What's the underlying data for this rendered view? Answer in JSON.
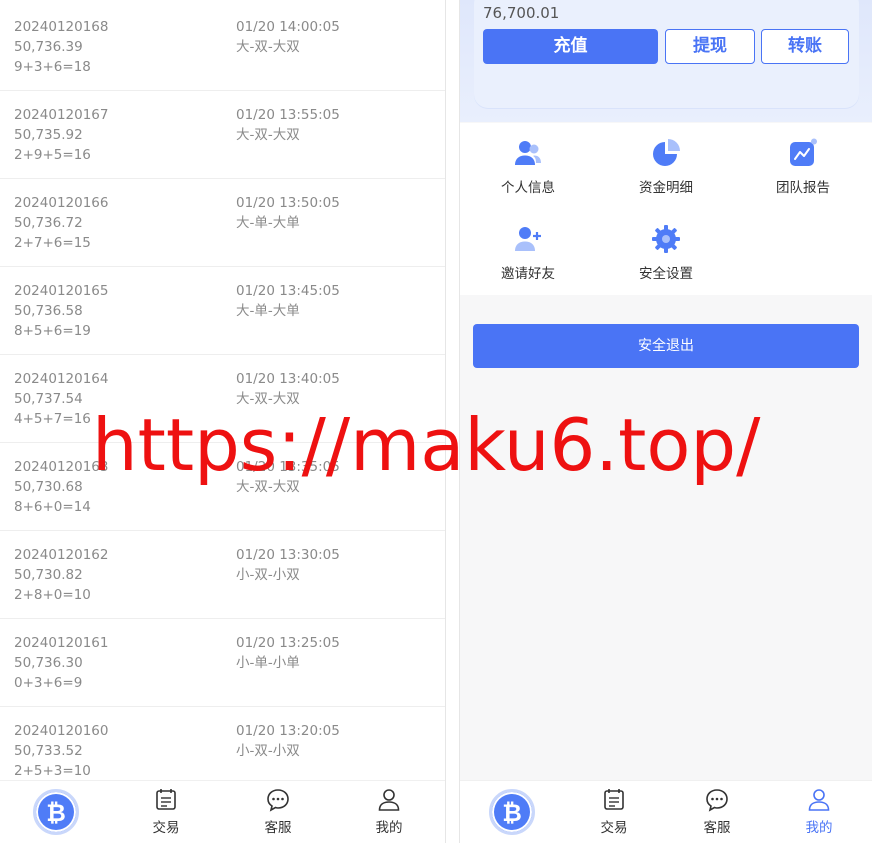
{
  "records": [
    {
      "issue": "20240120168",
      "price": "50,736.39",
      "sum": "9+3+6=18",
      "time": "01/20 14:00:05",
      "result": "大-双-大双"
    },
    {
      "issue": "20240120167",
      "price": "50,735.92",
      "sum": "2+9+5=16",
      "time": "01/20 13:55:05",
      "result": "大-双-大双"
    },
    {
      "issue": "20240120166",
      "price": "50,736.72",
      "sum": "2+7+6=15",
      "time": "01/20 13:50:05",
      "result": "大-单-大单"
    },
    {
      "issue": "20240120165",
      "price": "50,736.58",
      "sum": "8+5+6=19",
      "time": "01/20 13:45:05",
      "result": "大-单-大单"
    },
    {
      "issue": "20240120164",
      "price": "50,737.54",
      "sum": "4+5+7=16",
      "time": "01/20 13:40:05",
      "result": "大-双-大双"
    },
    {
      "issue": "20240120163",
      "price": "50,730.68",
      "sum": "8+6+0=14",
      "time": "01/20 13:35:05",
      "result": "大-双-大双"
    },
    {
      "issue": "20240120162",
      "price": "50,730.82",
      "sum": "2+8+0=10",
      "time": "01/20 13:30:05",
      "result": "小-双-小双"
    },
    {
      "issue": "20240120161",
      "price": "50,736.30",
      "sum": "0+3+6=9",
      "time": "01/20 13:25:05",
      "result": "小-单-小单"
    },
    {
      "issue": "20240120160",
      "price": "50,733.52",
      "sum": "2+5+3=10",
      "time": "01/20 13:20:05",
      "result": "小-双-小双"
    }
  ],
  "tabbar_left": {
    "logo_glyph": "₿",
    "trade": "交易",
    "service": "客服",
    "mine": "我的"
  },
  "tabbar_right": {
    "logo_glyph": "₿",
    "trade": "交易",
    "service": "客服",
    "mine": "我的",
    "active": "mine"
  },
  "account": {
    "balance": "76,700.01",
    "recharge_label": "充值",
    "withdraw_label": "提现",
    "transfer_label": "转账"
  },
  "menu": {
    "personal_info": "个人信息",
    "fund_details": "资金明细",
    "team_report": "团队报告",
    "invite_friends": "邀请好友",
    "security_settings": "安全设置"
  },
  "logout_label": "安全退出",
  "watermark": "https://maku6.top/",
  "colors": {
    "accent": "#4a74f5",
    "watermark": "#ee1111",
    "text_muted": "#8a8a8a"
  },
  "icons": {
    "tab_logo": "bitcoin-logo",
    "tab_trade": "calendar-list-icon",
    "tab_service": "chat-bubble-icon",
    "tab_mine": "user-icon",
    "menu_personal": "users-icon",
    "menu_fund": "pie-chart-icon",
    "menu_team": "trend-chart-icon",
    "menu_invite": "user-plus-icon",
    "menu_security": "gear-icon"
  }
}
